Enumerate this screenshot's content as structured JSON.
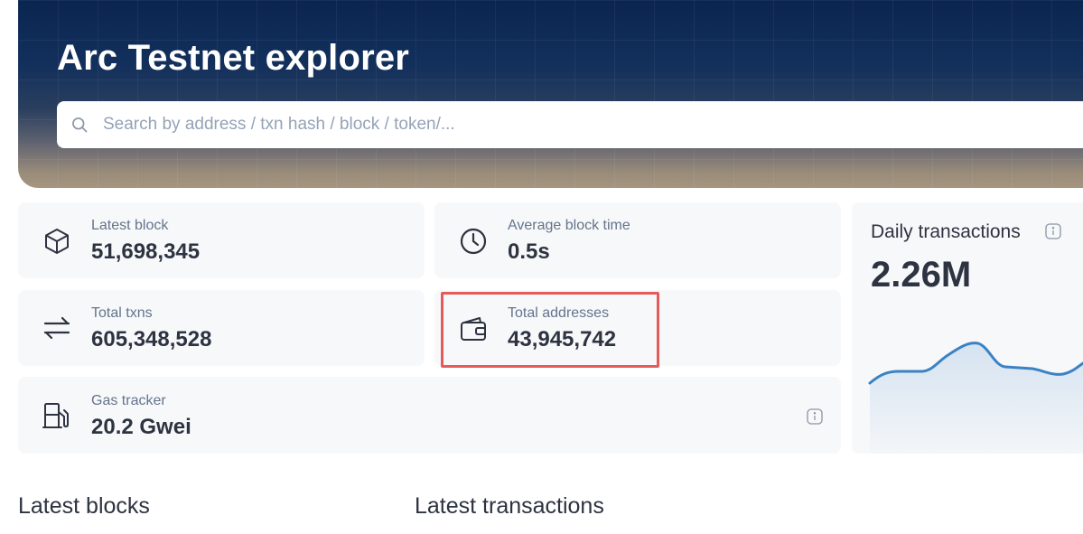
{
  "hero": {
    "title": "Arc Testnet explorer",
    "search_placeholder": "Search by address / txn hash / block / token/..."
  },
  "stats": {
    "latest_block": {
      "label": "Latest block",
      "value": "51,698,345",
      "icon": "cube-icon"
    },
    "average_block_time": {
      "label": "Average block time",
      "value": "0.5s",
      "icon": "clock-icon"
    },
    "total_txns": {
      "label": "Total txns",
      "value": "605,348,528",
      "icon": "transfer-arrows-icon"
    },
    "total_addresses": {
      "label": "Total addresses",
      "value": "43,945,742",
      "icon": "wallet-icon"
    },
    "gas_tracker": {
      "label": "Gas tracker",
      "value": "20.2 Gwei",
      "icon": "gas-pump-icon"
    }
  },
  "daily_transactions": {
    "title": "Daily transactions",
    "value": "2.26M",
    "line_color": "#3b82c4"
  },
  "sections": {
    "latest_blocks": "Latest blocks",
    "latest_transactions": "Latest transactions"
  },
  "colors": {
    "highlight_border": "#e65a5a",
    "card_background": "#f7f8fa"
  }
}
